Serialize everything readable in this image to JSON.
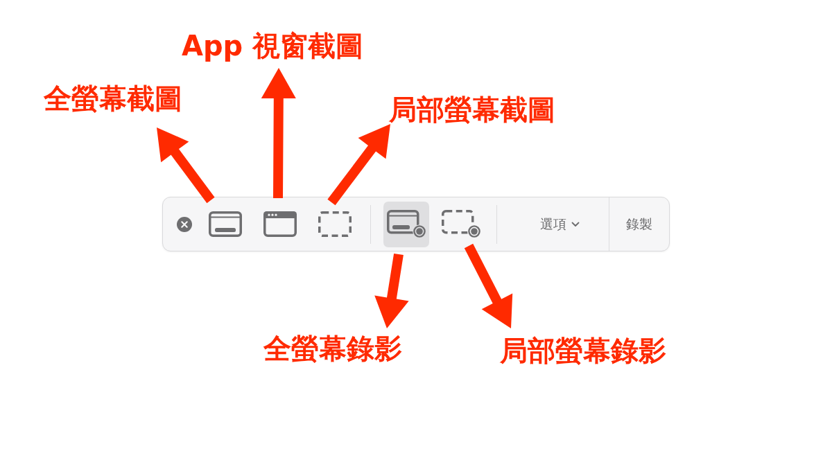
{
  "toolbar": {
    "tool_groups": [
      {
        "tools": [
          {
            "kind": "capture-screen",
            "selected": false,
            "caption": "全螢幕截圖"
          },
          {
            "kind": "capture-window",
            "selected": false,
            "caption": "App 視窗截圖"
          },
          {
            "kind": "capture-selection",
            "selected": false,
            "caption": "局部螢幕截圖"
          }
        ]
      },
      {
        "tools": [
          {
            "kind": "record-screen",
            "selected": true,
            "caption": "全螢幕錄影"
          },
          {
            "kind": "record-selection",
            "selected": false,
            "caption": "局部螢幕錄影"
          }
        ]
      }
    ],
    "options_button": {
      "label": "選項"
    },
    "record_button": {
      "label": "錄製"
    }
  }
}
